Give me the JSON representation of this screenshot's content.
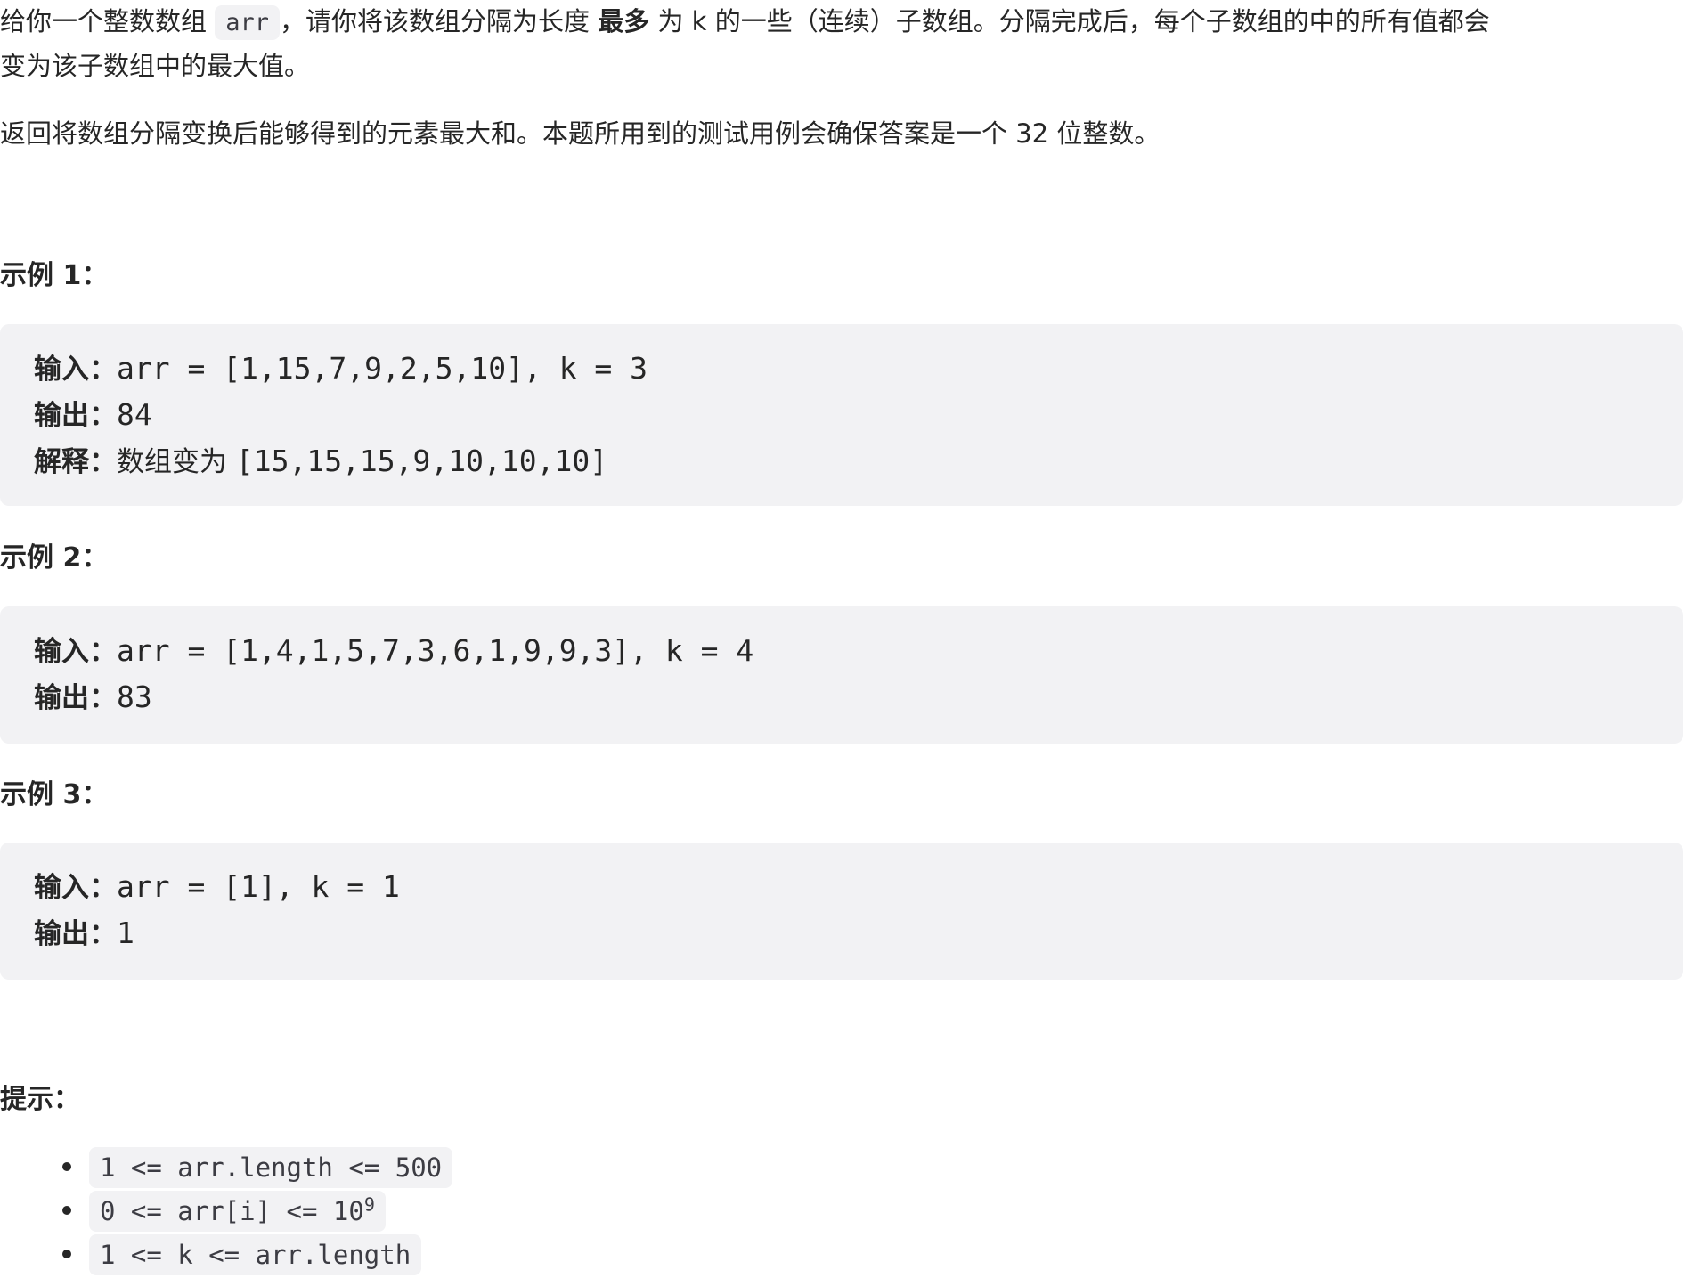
{
  "description": {
    "p1_part1": "给你一个整数数组 ",
    "p1_code": "arr",
    "p1_part2": "，请你将该数组分隔为长度 ",
    "p1_bold": "最多",
    "p1_part3": " 为 k 的一些（连续）子数组。分隔完成后，每个子数组的中的所有值都会",
    "p1_line2": "变为该子数组中的最大值。",
    "p2": "返回将数组分隔变换后能够得到的元素最大和。本题所用到的测试用例会确保答案是一个 32 位整数。"
  },
  "examples": [
    {
      "heading": "示例 1：",
      "input_label": "输入：",
      "input_value": "arr = [1,15,7,9,2,5,10], k = 3",
      "output_label": "输出：",
      "output_value": "84",
      "explain_label": "解释：",
      "explain_cn": "数组变为 ",
      "explain_value": "[15,15,15,9,10,10,10]"
    },
    {
      "heading": "示例 2：",
      "input_label": "输入：",
      "input_value": "arr = [1,4,1,5,7,3,6,1,9,9,3], k = 4",
      "output_label": "输出：",
      "output_value": "83"
    },
    {
      "heading": "示例 3：",
      "input_label": "输入：",
      "input_value": "arr = [1], k = 1",
      "output_label": "输出：",
      "output_value": "1"
    }
  ],
  "constraints": {
    "heading": "提示：",
    "c1": "1 <= arr.length <= 500",
    "c2_base": "0 <= arr[i] <= 10",
    "c2_exp": "9",
    "c3": "1 <= k <= arr.length"
  }
}
